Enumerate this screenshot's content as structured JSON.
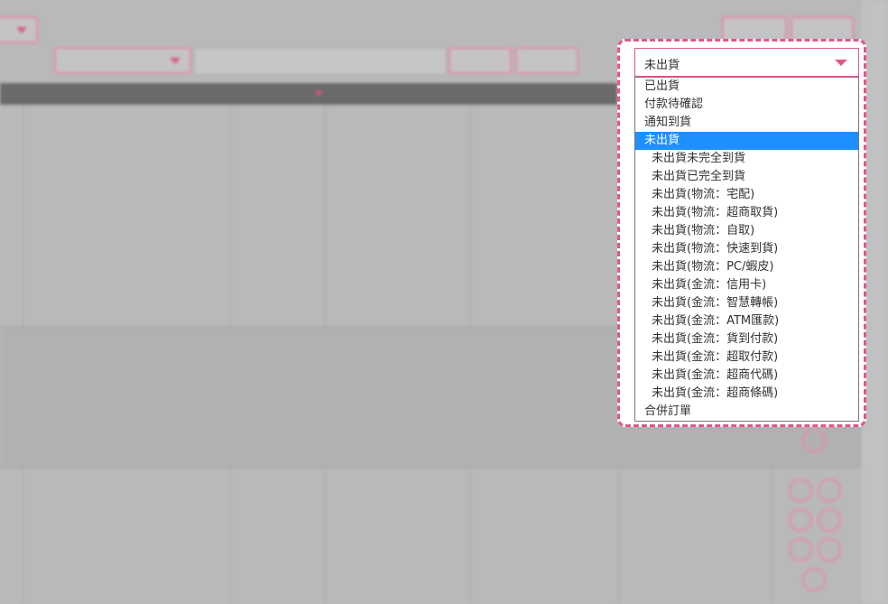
{
  "dropdown": {
    "selected_value": "未出貨",
    "options": [
      {
        "label": "已出貨",
        "indent": false,
        "selected": false
      },
      {
        "label": "付款待確認",
        "indent": false,
        "selected": false
      },
      {
        "label": "通知到貨",
        "indent": false,
        "selected": false
      },
      {
        "label": "未出貨",
        "indent": false,
        "selected": true
      },
      {
        "label": "未出貨未完全到貨",
        "indent": true,
        "selected": false
      },
      {
        "label": "未出貨已完全到貨",
        "indent": true,
        "selected": false
      },
      {
        "label": "未出貨(物流：宅配)",
        "indent": true,
        "selected": false
      },
      {
        "label": "未出貨(物流：超商取貨)",
        "indent": true,
        "selected": false
      },
      {
        "label": "未出貨(物流：自取)",
        "indent": true,
        "selected": false
      },
      {
        "label": "未出貨(物流：快速到貨)",
        "indent": true,
        "selected": false
      },
      {
        "label": "未出貨(物流：PC/蝦皮)",
        "indent": true,
        "selected": false
      },
      {
        "label": "未出貨(金流：信用卡)",
        "indent": true,
        "selected": false
      },
      {
        "label": "未出貨(金流：智慧轉帳)",
        "indent": true,
        "selected": false
      },
      {
        "label": "未出貨(金流：ATM匯款)",
        "indent": true,
        "selected": false
      },
      {
        "label": "未出貨(金流：貨到付款)",
        "indent": true,
        "selected": false
      },
      {
        "label": "未出貨(金流：超取付款)",
        "indent": true,
        "selected": false
      },
      {
        "label": "未出貨(金流：超商代碼)",
        "indent": true,
        "selected": false
      },
      {
        "label": "未出貨(金流：超商條碼)",
        "indent": true,
        "selected": false
      },
      {
        "label": "合併訂單",
        "indent": false,
        "selected": false
      }
    ]
  },
  "colors": {
    "accent": "#e0588a",
    "selected_option": "#1e90ff"
  }
}
